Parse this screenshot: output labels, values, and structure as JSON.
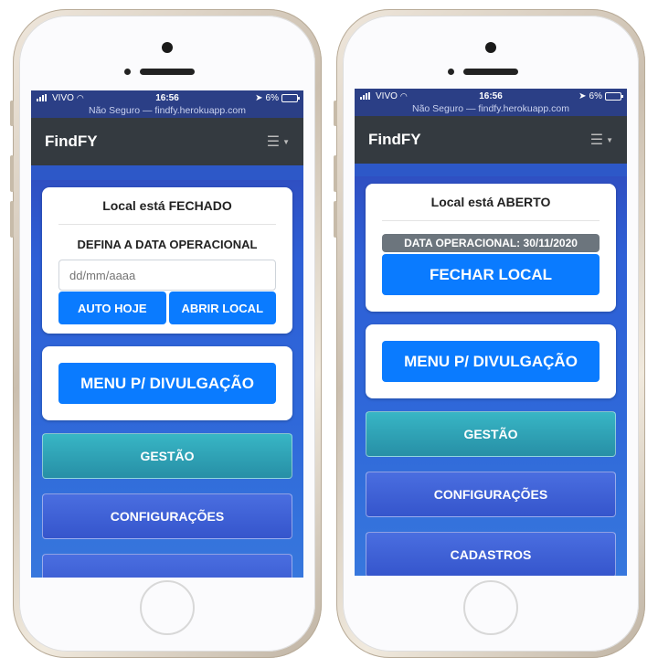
{
  "left_phone": {
    "status_bar": {
      "carrier": "VIVO",
      "time": "16:56",
      "battery": "6%"
    },
    "url_bar": {
      "text": "Não Seguro — findfy.herokuapp.com"
    },
    "navbar": {
      "brand": "FindFY",
      "menu_icon": "hamburger-icon"
    },
    "status_card": {
      "title": "Local está FECHADO",
      "subtitle": "DEFINA A DATA OPERACIONAL",
      "date_placeholder": "dd/mm/aaaa",
      "auto_button": "AUTO HOJE",
      "open_button": "ABRIR LOCAL"
    },
    "menu_card": {
      "button": "MENU P/ DIVULGAÇÃO"
    },
    "buttons": {
      "gestao": "GESTÃO",
      "configuracoes": "CONFIGURAÇÕES"
    }
  },
  "right_phone": {
    "status_bar": {
      "carrier": "VIVO",
      "time": "16:56",
      "battery": "6%"
    },
    "url_bar": {
      "text": "Não Seguro — findfy.herokuapp.com"
    },
    "navbar": {
      "brand": "FindFY",
      "menu_icon": "hamburger-icon"
    },
    "status_card": {
      "title": "Local está ABERTO",
      "badge": "DATA OPERACIONAL: 30/11/2020",
      "close_button": "FECHAR LOCAL"
    },
    "menu_card": {
      "button": "MENU P/ DIVULGAÇÃO"
    },
    "buttons": {
      "gestao": "GESTÃO",
      "configuracoes": "CONFIGURAÇÕES",
      "cadastros": "CADASTROS"
    }
  },
  "colors": {
    "primary": "#0a7bff",
    "navbar": "#343a40",
    "teal": "#2fa3b6",
    "badge": "#6c757d"
  }
}
